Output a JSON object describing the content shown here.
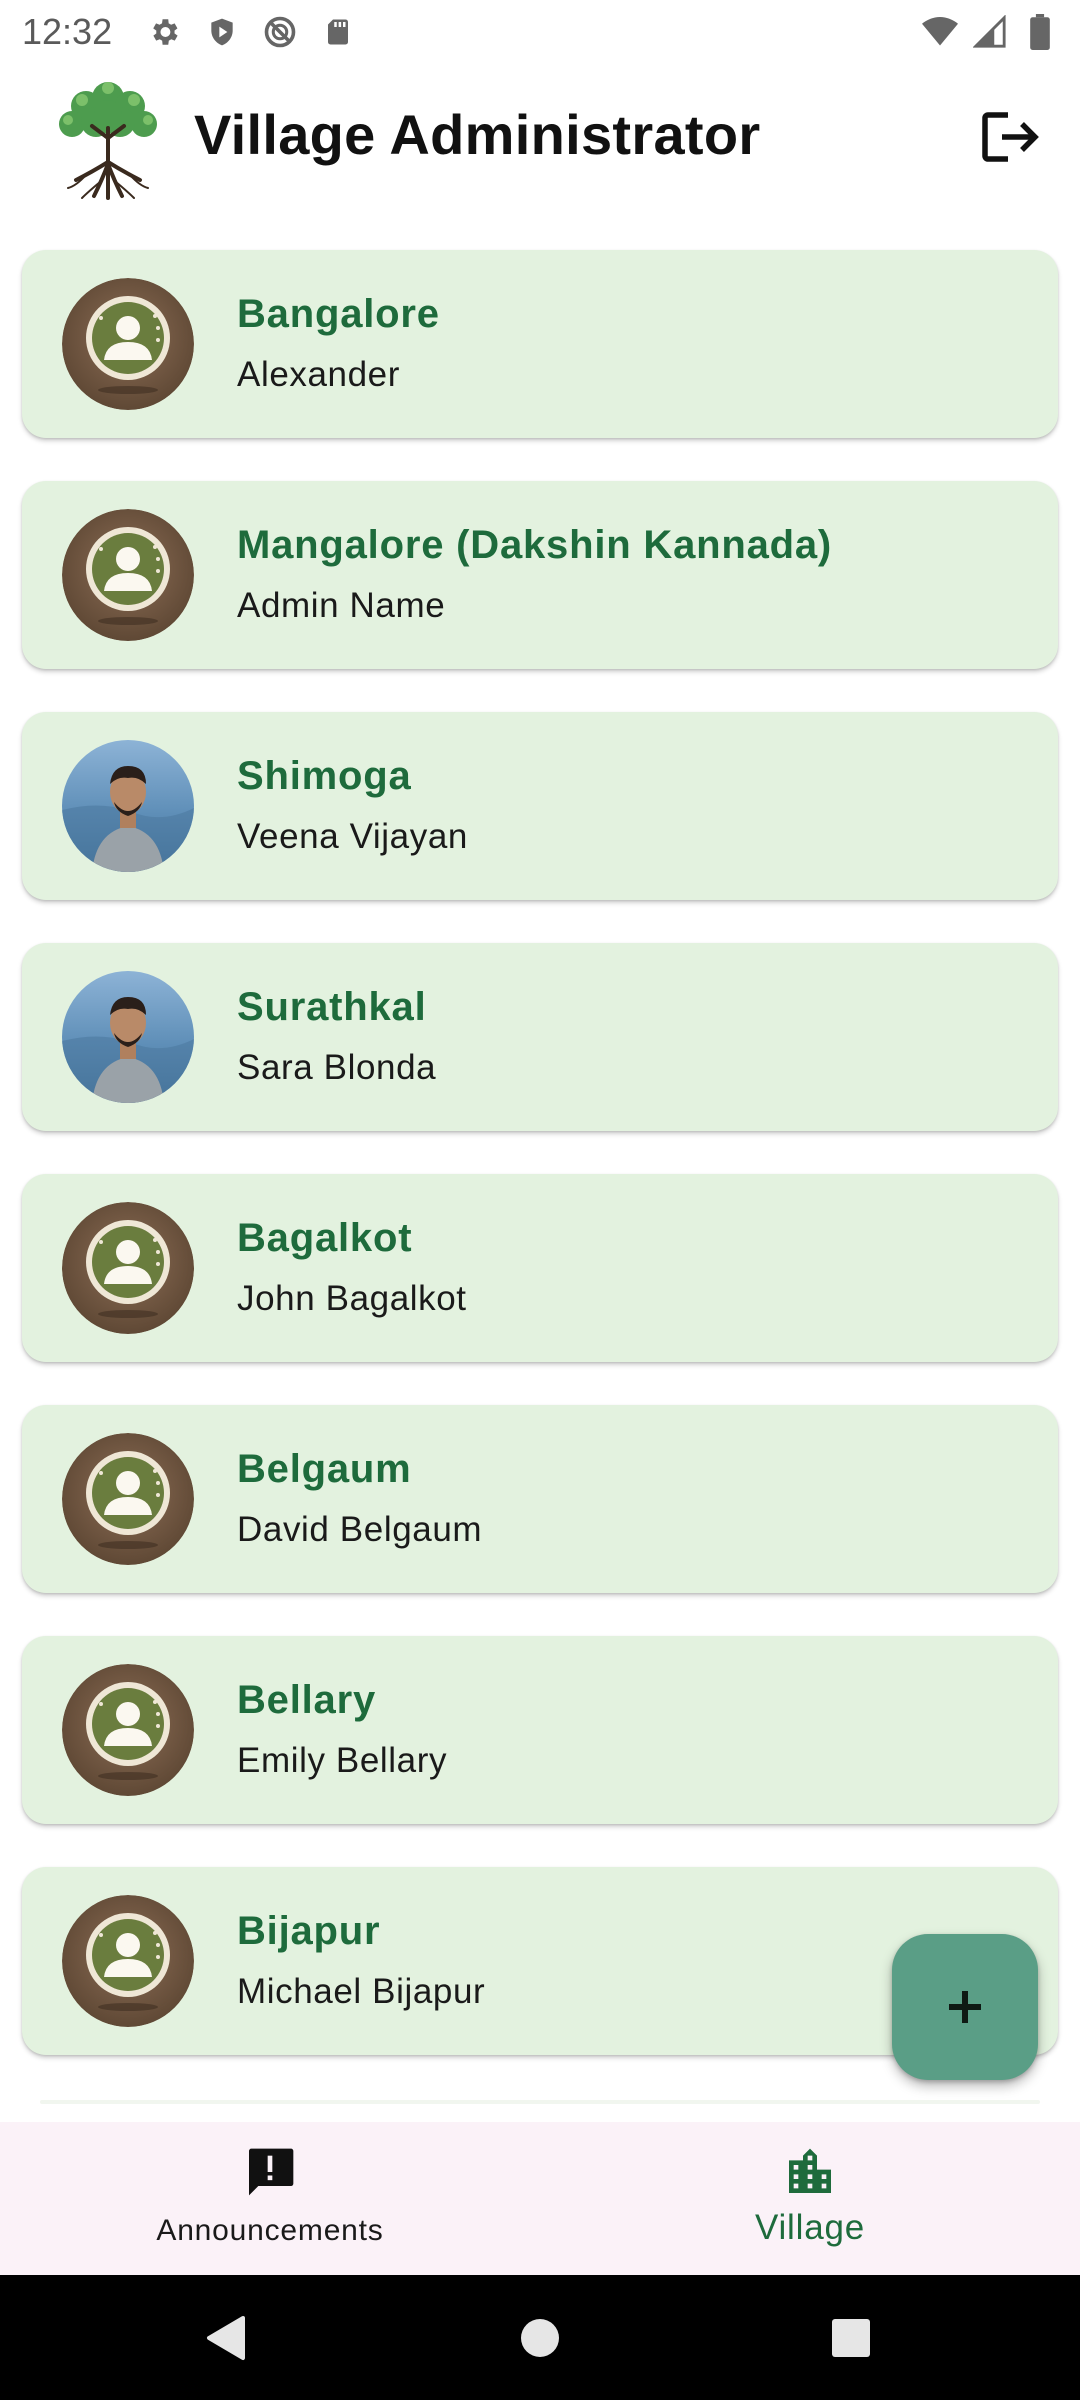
{
  "status_bar": {
    "time": "12:32",
    "left_icons": [
      "gear-icon",
      "shield-icon",
      "do-not-disturb-icon",
      "sd-card-icon"
    ],
    "right_icons": [
      "wifi-icon",
      "cell-signal-icon",
      "battery-icon"
    ]
  },
  "app_bar": {
    "title": "Village Administrator",
    "logo_icon": "tree-logo",
    "logout_icon": "logout-icon"
  },
  "villages": [
    {
      "name": "Bangalore",
      "admin": "Alexander",
      "avatar": "default-avatar"
    },
    {
      "name": "Mangalore (Dakshin Kannada)",
      "admin": "Admin Name",
      "avatar": "default-avatar"
    },
    {
      "name": "Shimoga",
      "admin": "Veena Vijayan",
      "avatar": "photo-avatar"
    },
    {
      "name": "Surathkal",
      "admin": "Sara Blonda",
      "avatar": "photo-avatar"
    },
    {
      "name": "Bagalkot",
      "admin": "John Bagalkot",
      "avatar": "default-avatar"
    },
    {
      "name": "Belgaum",
      "admin": "David Belgaum",
      "avatar": "default-avatar"
    },
    {
      "name": "Bellary",
      "admin": "Emily Bellary",
      "avatar": "default-avatar"
    },
    {
      "name": "Bijapur",
      "admin": "Michael Bijapur",
      "avatar": "default-avatar"
    }
  ],
  "fab": {
    "icon": "plus-icon"
  },
  "bottom_nav": {
    "items": [
      {
        "label": "Announcements",
        "icon": "announcement-icon",
        "active": false
      },
      {
        "label": "Village",
        "icon": "building-icon",
        "active": true
      }
    ]
  },
  "colors": {
    "card_bg": "#e3f2df",
    "title_green": "#1e6b3c",
    "fab_bg": "#5a9e86",
    "nav_bg": "#fbf2f8"
  }
}
